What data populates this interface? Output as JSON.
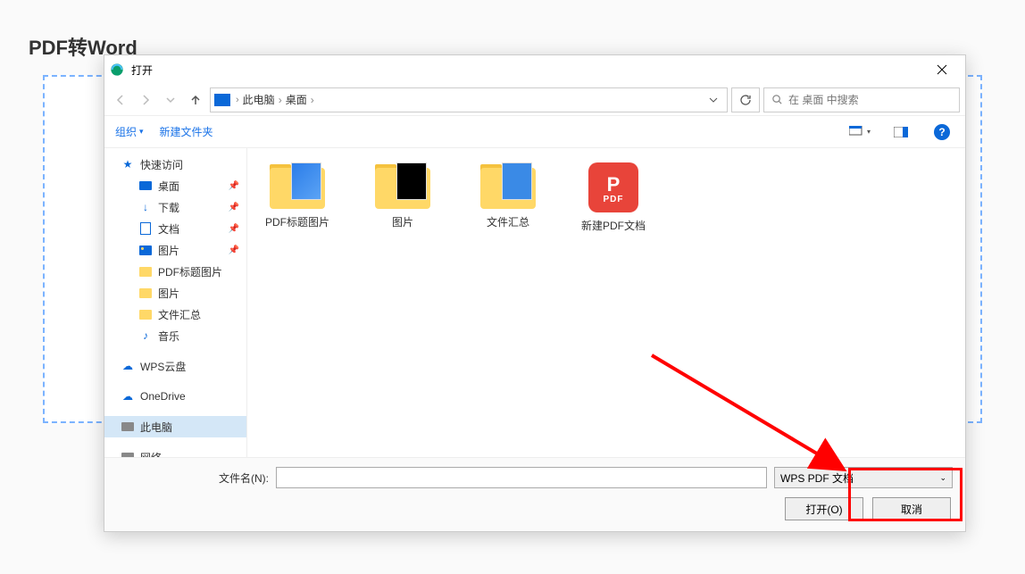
{
  "page": {
    "title": "PDF转Word"
  },
  "dialog": {
    "title": "打开",
    "breadcrumb": [
      "此电脑",
      "桌面"
    ],
    "search_placeholder": "在 桌面 中搜索",
    "toolbar": {
      "organize": "组织",
      "new_folder": "新建文件夹"
    }
  },
  "sidebar": {
    "quick_access": "快速访问",
    "items": [
      {
        "label": "桌面",
        "pinned": true
      },
      {
        "label": "下载",
        "pinned": true
      },
      {
        "label": "文档",
        "pinned": true
      },
      {
        "label": "图片",
        "pinned": true
      },
      {
        "label": "PDF标题图片"
      },
      {
        "label": "图片"
      },
      {
        "label": "文件汇总"
      },
      {
        "label": "音乐"
      }
    ],
    "wps": "WPS云盘",
    "onedrive": "OneDrive",
    "this_pc": "此电脑",
    "network": "网络"
  },
  "files": [
    {
      "name": "PDF标题图片",
      "type": "folder-blue"
    },
    {
      "name": "图片",
      "type": "folder-qr"
    },
    {
      "name": "文件汇总",
      "type": "folder-doc"
    },
    {
      "name": "新建PDF文档",
      "type": "pdf"
    }
  ],
  "footer": {
    "filename_label": "文件名(N):",
    "filetype": "WPS PDF 文档",
    "open": "打开(O)",
    "cancel": "取消"
  }
}
